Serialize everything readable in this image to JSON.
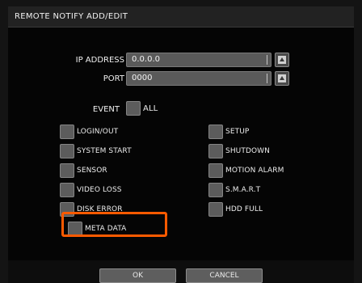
{
  "dialog": {
    "title": "REMOTE NOTIFY ADD/EDIT"
  },
  "network": {
    "ip_label": "IP ADDRESS",
    "ip_value": "0.0.0.0",
    "port_label": "PORT",
    "port_value": "0000"
  },
  "event": {
    "label": "EVENT",
    "all_label": "ALL"
  },
  "left_options": [
    {
      "label": "LOGIN/OUT"
    },
    {
      "label": "SYSTEM START"
    },
    {
      "label": "SENSOR"
    },
    {
      "label": "VIDEO LOSS"
    },
    {
      "label": "DISK ERROR"
    },
    {
      "label": "META DATA"
    }
  ],
  "right_options": [
    {
      "label": "SETUP"
    },
    {
      "label": "SHUTDOWN"
    },
    {
      "label": "MOTION ALARM"
    },
    {
      "label": "S.M.A.R.T"
    },
    {
      "label": "HDD FULL"
    }
  ],
  "footer": {
    "ok_label": "OK",
    "cancel_label": "CANCEL"
  },
  "colors": {
    "highlight": "#ff5a00"
  }
}
